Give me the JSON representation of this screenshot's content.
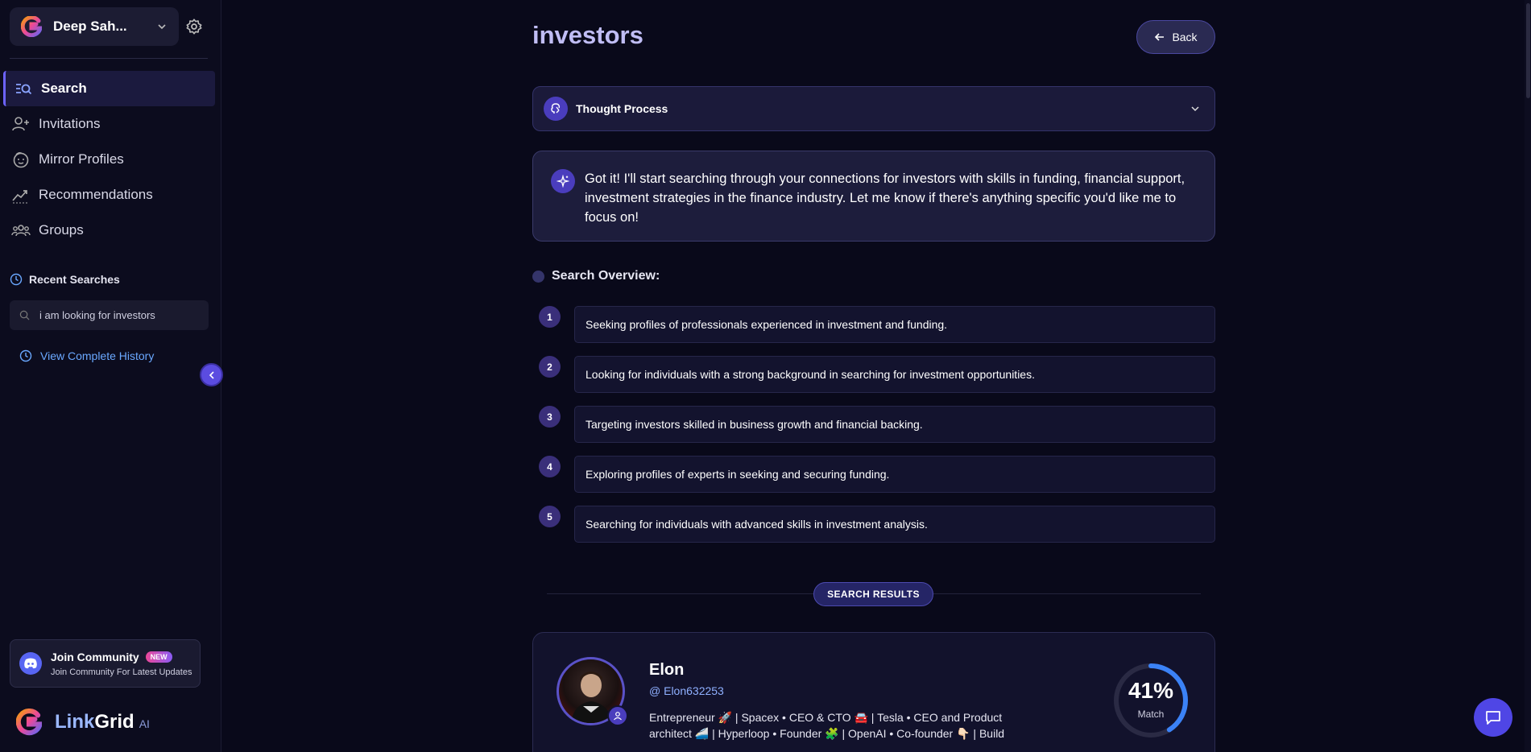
{
  "user": {
    "name": "Deep Sah..."
  },
  "nav": {
    "items": [
      {
        "label": "Search",
        "icon": "search-list-icon"
      },
      {
        "label": "Invitations",
        "icon": "user-plus-icon"
      },
      {
        "label": "Mirror Profiles",
        "icon": "face-icon"
      },
      {
        "label": "Recommendations",
        "icon": "trend-icon"
      },
      {
        "label": "Groups",
        "icon": "users-icon"
      }
    ]
  },
  "recent": {
    "title": "Recent Searches",
    "items": [
      "i am looking for investors"
    ],
    "history_label": "View Complete History"
  },
  "community": {
    "title": "Join Community",
    "badge": "NEW",
    "subtitle": "Join Community For Latest Updates"
  },
  "brand": {
    "name_a": "Link",
    "name_b": "Grid",
    "suffix": "AI"
  },
  "main": {
    "title": "investors",
    "back_label": "Back",
    "thought_label": "Thought Process",
    "message": "Got it! I'll start searching through your connections for investors with skills in funding, financial support, investment strategies in the finance industry. Let me know if there's anything specific you'd like me to focus on!",
    "overview_title": "Search Overview:",
    "steps": [
      {
        "num": "1",
        "text": "Seeking profiles of professionals experienced in investment and funding."
      },
      {
        "num": "2",
        "text": "Looking for individuals with a strong background in searching for investment opportunities."
      },
      {
        "num": "3",
        "text": "Targeting investors skilled in business growth and financial backing."
      },
      {
        "num": "4",
        "text": "Exploring profiles of experts in seeking and securing funding."
      },
      {
        "num": "5",
        "text": "Searching for individuals with advanced skills in investment analysis."
      }
    ],
    "results_label": "SEARCH RESULTS",
    "results": [
      {
        "name": "Elon",
        "handle": "@ Elon632253",
        "bio": "Entrepreneur 🚀 | Spacex • CEO & CTO 🚘 | Tesla • CEO and Product architect 🚄 | Hyperloop • Founder 🧩 | OpenAI • Co-founder 👇🏻 | Build ...",
        "match_pct": "41%",
        "match_value": 0.41,
        "match_label": "Match"
      }
    ]
  },
  "colors": {
    "accent": "#6c63ff",
    "background": "#09091a",
    "link": "#6aa8ff"
  }
}
